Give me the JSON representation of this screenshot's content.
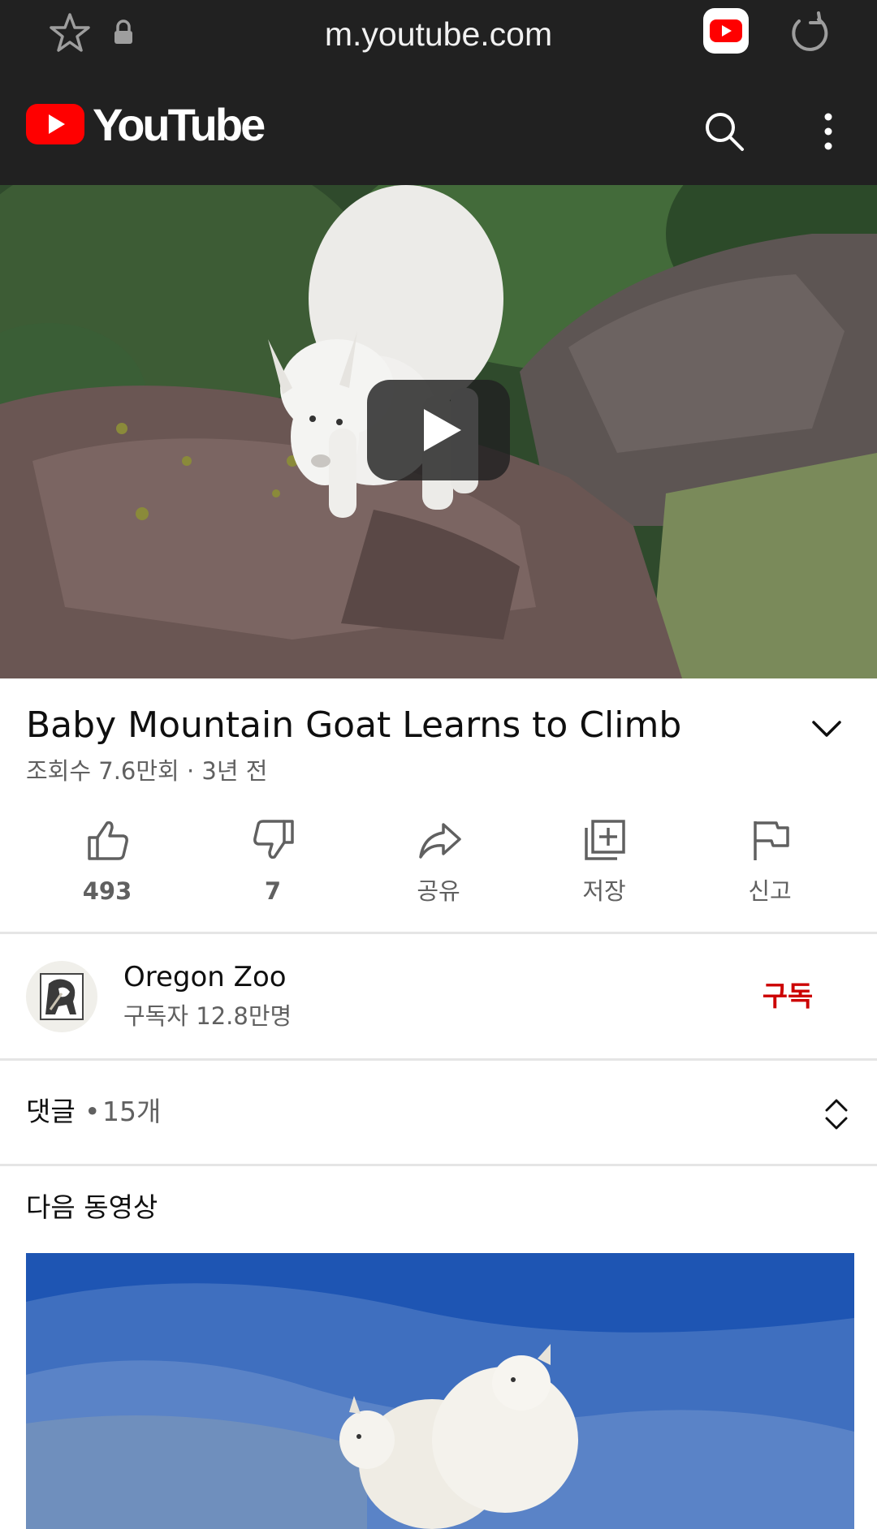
{
  "browser": {
    "url": "m.youtube.com",
    "icons": [
      "star-icon",
      "lock-icon",
      "youtube-app-icon",
      "reload-icon"
    ]
  },
  "header": {
    "logo_text": "YouTube",
    "icons": [
      "search-icon",
      "more-vert-icon"
    ]
  },
  "video": {
    "title": "Baby Mountain Goat Learns to Climb",
    "meta": "조회수 7.6만회 · 3년 전"
  },
  "actions": [
    {
      "name": "like",
      "label": "493",
      "icon": "thumbs-up-icon"
    },
    {
      "name": "dislike",
      "label": "7",
      "icon": "thumbs-down-icon"
    },
    {
      "name": "share",
      "label": "공유",
      "icon": "share-icon"
    },
    {
      "name": "save",
      "label": "저장",
      "icon": "add-to-playlist-icon"
    },
    {
      "name": "report",
      "label": "신고",
      "icon": "flag-icon"
    }
  ],
  "channel": {
    "name": "Oregon Zoo",
    "subscribers": "구독자 12.8만명",
    "subscribe_label": "구독"
  },
  "comments": {
    "label": "댓글",
    "separator": "•",
    "count": "15개"
  },
  "up_next": {
    "title": "다음 동영상"
  },
  "colors": {
    "header_bg": "#212121",
    "brand_red": "#ff0000",
    "subscribe_red": "#cc0000",
    "secondary_text": "#606060"
  }
}
